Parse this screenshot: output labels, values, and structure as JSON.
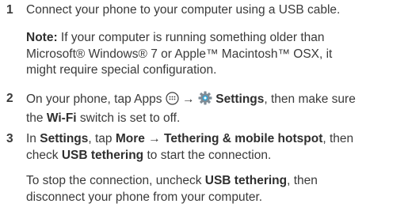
{
  "steps": [
    {
      "number": "1",
      "line1": "Connect your phone to your computer using a USB cable."
    },
    {
      "note_label": "Note:",
      "note_line1": " If your computer is running something older than",
      "note_line2": "Microsoft® Windows® 7 or Apple™ Macintosh™ OSX, it",
      "note_line3": "might require special configuration."
    },
    {
      "number": "2",
      "line1_a": "On your phone, tap Apps ",
      "arrow": " → ",
      "settings_label": "Settings",
      "line1_b": ", then make sure",
      "line2_a": "the ",
      "wifi_label": "Wi-Fi",
      "line2_b": " switch is set to off."
    },
    {
      "number": "3",
      "line1_a": "In ",
      "settings_label": "Settings",
      "line1_b": ", tap ",
      "more_label": "More",
      "arrow": " → ",
      "tethering_label": "Tethering & mobile hotspot",
      "line1_c": ", then",
      "line2_a": "check ",
      "usb_label": "USB tethering",
      "line2_b": " to start the connection."
    },
    {
      "line1_a": "To stop the connection, uncheck ",
      "usb_label": "USB tethering",
      "line1_b": ", then",
      "line2": "disconnect your phone from your computer."
    }
  ],
  "icons": [
    "apps-icon",
    "settings-gear-icon"
  ]
}
